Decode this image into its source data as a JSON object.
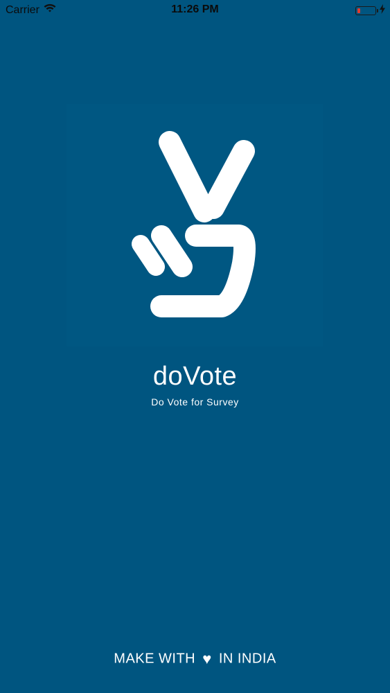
{
  "status_bar": {
    "carrier": "Carrier",
    "time": "11:26 PM",
    "battery_level": 0.15
  },
  "icons": {
    "wifi": "wifi-icon",
    "battery": "battery-icon",
    "charging": "charging-bolt-icon",
    "heart": "heart-icon",
    "logo": "peace-hand-logo"
  },
  "colors": {
    "background": "#005580",
    "text": "#ffffff",
    "battery_low": "#e23b2e"
  },
  "splash": {
    "app_name": "doVote",
    "tagline": "Do Vote for Survey"
  },
  "footer": {
    "prefix": "MAKE WITH",
    "heart": "♥",
    "suffix": "IN INDIA"
  }
}
